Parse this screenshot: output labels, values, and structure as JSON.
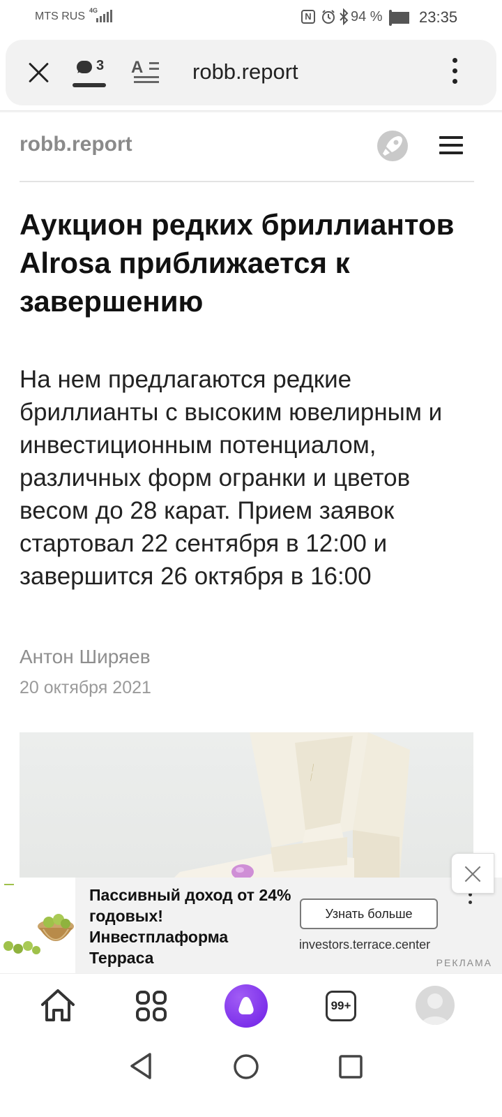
{
  "status_bar": {
    "carrier": "MTS RUS",
    "network": "4G",
    "battery": "94 %",
    "battery_level": 0.94,
    "time": "23:35"
  },
  "browser": {
    "url": "robb.report",
    "comments_count": "3",
    "tabs_count": "99+"
  },
  "site": {
    "logo": "robb.report"
  },
  "article": {
    "title": "Аукцион редких бриллиантов Alrosa приближается к завершению",
    "lead": "На нем предлагаются редкие бриллианты с высоким ювелирным и инвестиционным потенциалом, различных форм огранки и цветов весом до 28 карат. Прием заявок стартовал 22 сентября в 12:00 и завершится 26 октября в 16:00",
    "author": "Антон Ширяев",
    "date": "20 октября 2021"
  },
  "ad": {
    "text": "Пассивный доход от 24% годовых! Инвестплаформа Терраса",
    "cta": "Узнать больше",
    "url": "investors.terrace.center",
    "label": "РЕКЛАМА"
  },
  "colors": {
    "alice_accent": "#7b2cf0",
    "muted_text": "#8e8e8e"
  }
}
